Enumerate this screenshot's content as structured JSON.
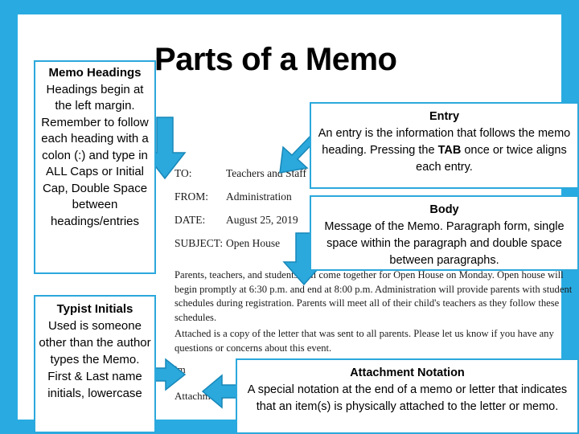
{
  "slide": {
    "title": "Parts of a Memo",
    "frame_color": "#29ABE2",
    "box_border_color": "#2BA8DC",
    "arrow_fill_color": "#2BA8DC"
  },
  "callouts": {
    "memo_headings": {
      "heading": "Memo Headings",
      "text": "Headings begin at the left margin. Remember to follow each heading with a colon (:) and type in ALL Caps or Initial Cap, Double Space between headings/entries"
    },
    "typist_initials": {
      "heading": "Typist Initials",
      "text": "Used is someone other than the author types the Memo. First & Last name initials, lowercase"
    },
    "entry": {
      "heading": "Entry",
      "text_part1": "An entry is the information that follows the memo heading.  Pressing the ",
      "emphasis": "TAB",
      "text_part2": " once or twice aligns each entry."
    },
    "body": {
      "heading": "Body",
      "text": "Message of the Memo. Paragraph form, single space within the paragraph and double space between paragraphs."
    },
    "attachment_notation": {
      "heading": "Attachment Notation",
      "text": "A special notation at the end of a memo or letter that indicates that an item(s) is physically attached to the letter or memo."
    }
  },
  "memo": {
    "headings": [
      {
        "label": "TO:",
        "value": "Teachers and Staff"
      },
      {
        "label": "FROM:",
        "value": "Administration"
      },
      {
        "label": "DATE:",
        "value": "August 25, 2019"
      },
      {
        "label": "SUBJECT:",
        "value": "Open House"
      }
    ],
    "paragraph_1": "Parents, teachers, and students will come together for Open House on Monday.  Open house will begin promptly at 6:30 p.m. and end at 8:00 p.m.  Administration will provide parents with student schedules during registration.  Parents will meet all of their child's teachers as they follow these schedules.",
    "paragraph_2": "Attached is a copy of the letter that was sent to all parents.  Please let us know if you have any questions or concerns about this event.",
    "typist_initials": "jm",
    "attachment_line": "Attachment"
  },
  "arrows": [
    {
      "name": "arrow-down-to-headings",
      "direction": "down"
    },
    {
      "name": "arrow-diagonal-to-entry",
      "direction": "down-left"
    },
    {
      "name": "arrow-down-to-body",
      "direction": "down"
    },
    {
      "name": "arrow-right-to-initials",
      "direction": "right"
    },
    {
      "name": "arrow-left-to-attachment",
      "direction": "left"
    }
  ]
}
